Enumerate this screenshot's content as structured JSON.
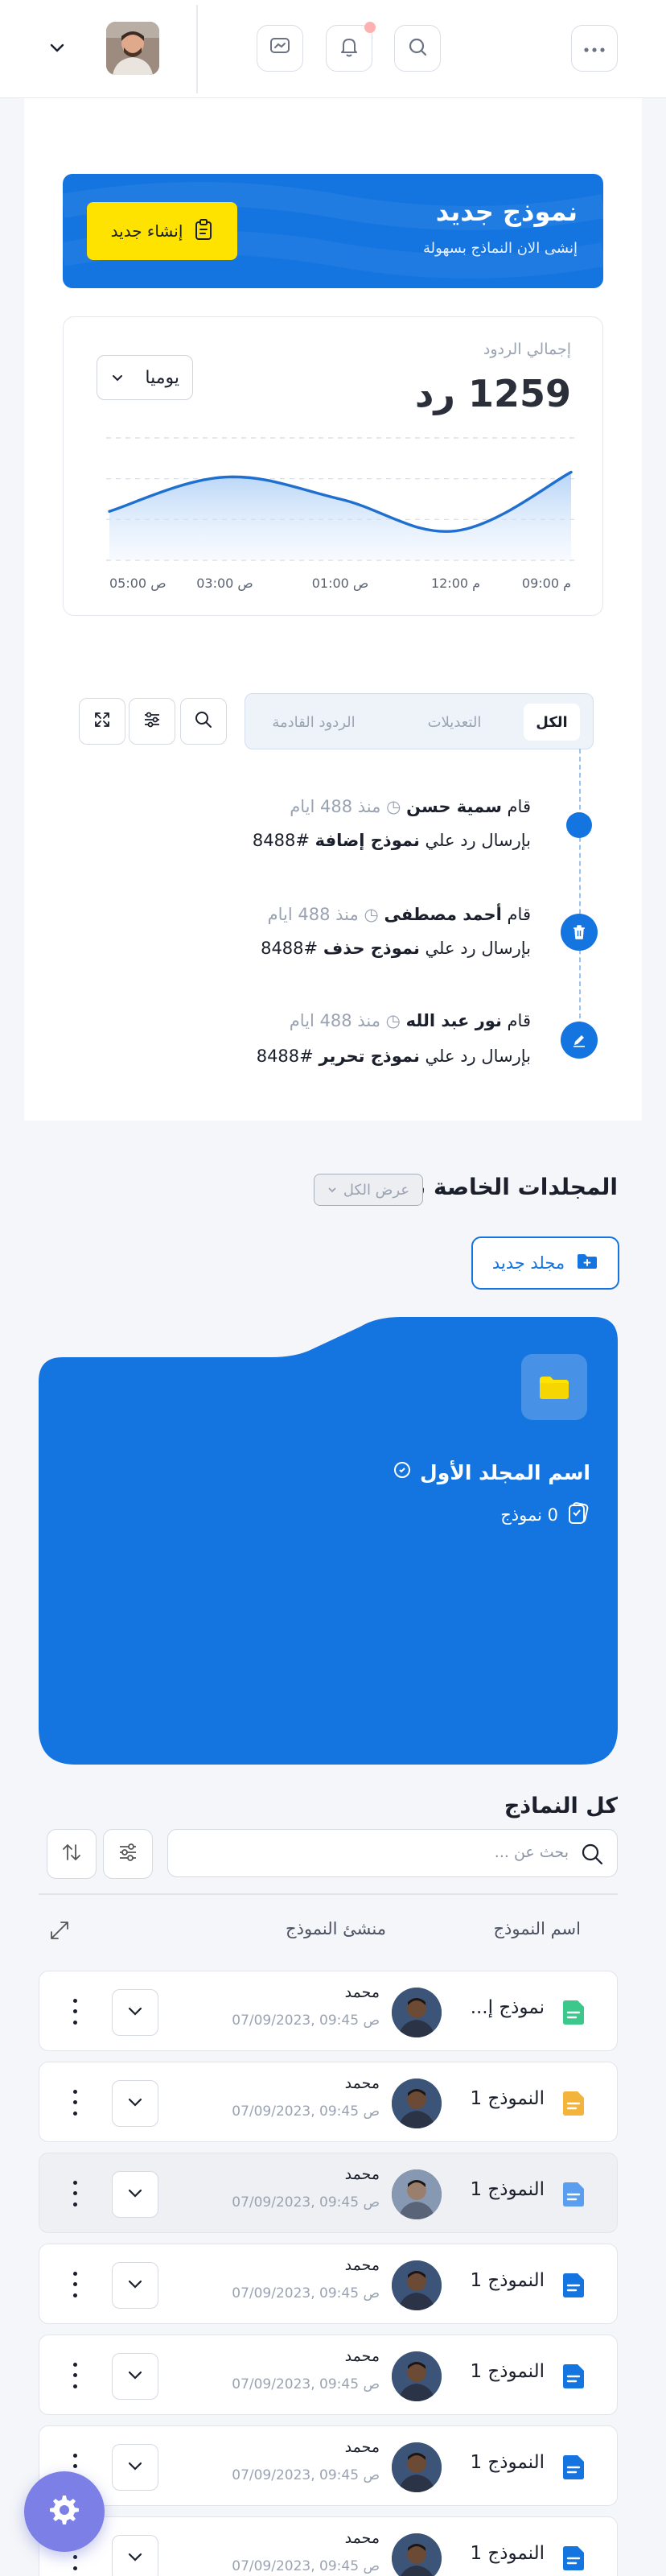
{
  "header": {
    "icons": [
      "chevron-down-icon",
      "avatar",
      "message-icon",
      "bell-icon",
      "search-icon",
      "more-icon"
    ]
  },
  "banner": {
    "title": "نموذج جديد",
    "subtitle": "إنشى الان النماذج بسهولة",
    "button_label": "إنشاء جديد",
    "color": "#1474e0",
    "button_color": "#ffe300"
  },
  "responses": {
    "label": "إجمالي الردود",
    "total": "1259 رد",
    "period": "يوميا"
  },
  "chart_data": {
    "type": "area",
    "x": [
      "09:00 م",
      "12:00 م",
      "01:00 ص",
      "03:00 ص",
      "05:00 ص"
    ],
    "series": [
      {
        "values": [
          0.72,
          0.24,
          0.5,
          0.68,
          0.4
        ]
      }
    ],
    "grid": true
  },
  "activity": {
    "tabs": [
      "الكل",
      "التعديلات",
      "الردود القادمة"
    ],
    "active_tab": 0,
    "items": [
      {
        "prefix": "قام",
        "name": "سمية حسن",
        "time": "منذ 488 ايام",
        "line_prefix": "بإرسال رد علي",
        "form": "نموذج إضافة",
        "ref": "#8488",
        "icon": "dot-icon"
      },
      {
        "prefix": "قام",
        "name": "أحمد مصطفى",
        "time": "منذ 488 ايام",
        "line_prefix": "بإرسال رد علي",
        "form": "نموذج حذف",
        "ref": "#8488",
        "icon": "trash-icon"
      },
      {
        "prefix": "قام",
        "name": "نور عبد الله",
        "time": "منذ 488 ايام",
        "line_prefix": "بإرسال رد علي",
        "form": "نموذج تحرير",
        "ref": "#8488",
        "icon": "pen-icon"
      }
    ]
  },
  "folders": {
    "title": "المجلدات الخاصة بي",
    "view_all": "عرض الكل",
    "new_folder": "مجلد جديد",
    "items": [
      {
        "name": "اسم المجلد الأول",
        "count": "0 نموذج"
      }
    ]
  },
  "forms": {
    "title": "كل النماذج",
    "search_placeholder": "بحث عن ...",
    "columns": [
      "اسم النموذج",
      "منشئ النموذج"
    ],
    "rows": [
      {
        "name": "نموذج إ...",
        "creator": "محمد",
        "date": "07/09/2023, 09:45 ص",
        "icon_color": "#3cc88a",
        "highlight": false,
        "avatar_tone": "dark"
      },
      {
        "name": "النموذج 1",
        "creator": "محمد",
        "date": "07/09/2023, 09:45 ص",
        "icon_color": "#f2b43a",
        "highlight": false,
        "avatar_tone": "dark"
      },
      {
        "name": "النموذج 1",
        "creator": "محمد",
        "date": "07/09/2023, 09:45 ص",
        "icon_color": "#5a9ef0",
        "highlight": true,
        "avatar_tone": "light"
      },
      {
        "name": "النموذج 1",
        "creator": "محمد",
        "date": "07/09/2023, 09:45 ص",
        "icon_color": "#1474e0",
        "highlight": false,
        "avatar_tone": "dark"
      },
      {
        "name": "النموذج 1",
        "creator": "محمد",
        "date": "07/09/2023, 09:45 ص",
        "icon_color": "#1474e0",
        "highlight": false,
        "avatar_tone": "dark"
      },
      {
        "name": "النموذج 1",
        "creator": "محمد",
        "date": "07/09/2023, 09:45 ص",
        "icon_color": "#1474e0",
        "highlight": false,
        "avatar_tone": "dark"
      },
      {
        "name": "النموذج 1",
        "creator": "محمد",
        "date": "07/09/2023, 09:45 ص",
        "icon_color": "#1474e0",
        "highlight": false,
        "avatar_tone": "dark"
      }
    ]
  }
}
